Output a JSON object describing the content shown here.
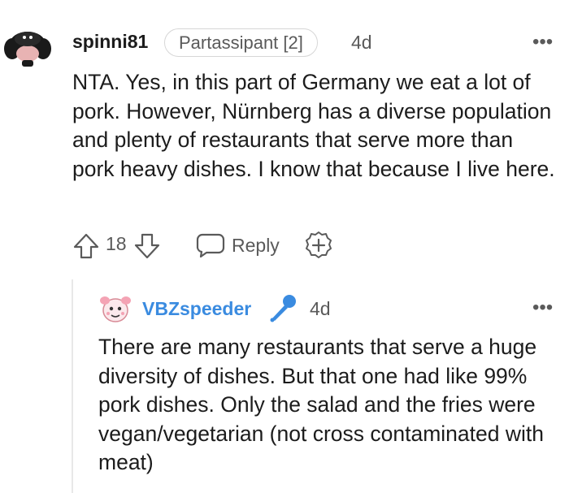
{
  "comments": [
    {
      "username": "spinni81",
      "flair": "Partassipant [2]",
      "time": "4d",
      "more_label": "•••",
      "body": "NTA. Yes, in this part of Germany we eat a lot of pork. However, Nürnberg has a diverse population and plenty of restaurants that serve more than pork heavy dishes. I know that because I live here.",
      "score": "18",
      "reply_label": "Reply"
    },
    {
      "username": "VBZspeeder",
      "time": "4d",
      "more_label": "•••",
      "body": "There are many restaurants that serve a huge diversity of dishes. But that one had like 99% pork dishes. Only the salad and the fries were vegan/vegetarian (not cross contaminated with meat)"
    }
  ],
  "colors": {
    "text": "#1c1c1c",
    "meta": "#5a5a5a",
    "username_link": "#3a8be0",
    "flair_border": "#d6d6d6",
    "thread_line": "#e8e8e8"
  },
  "icons": {
    "avatar1": "snoo-avatar-dark-hair",
    "avatar2": "snoo-avatar-pink",
    "upvote": "upvote-arrow-icon",
    "downvote": "downvote-arrow-icon",
    "reply": "speech-bubble-icon",
    "award": "add-award-icon",
    "mic": "microphone-icon",
    "more": "more-options-icon"
  }
}
